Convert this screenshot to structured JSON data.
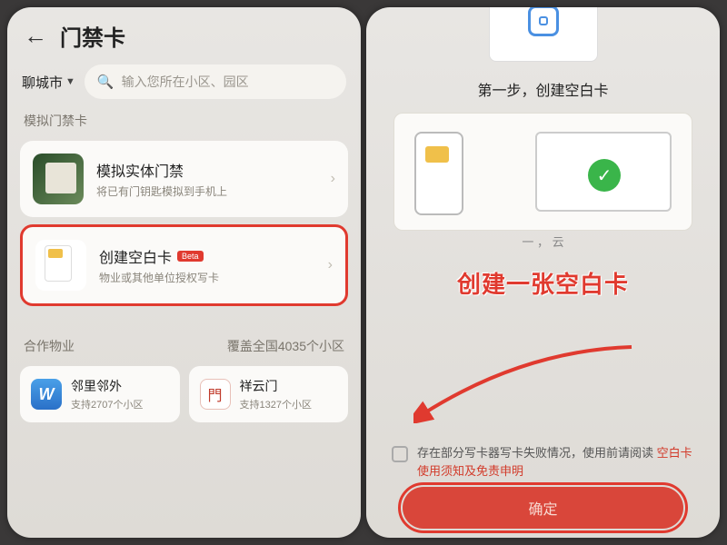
{
  "left": {
    "title": "门禁卡",
    "city": "聊城市",
    "search_placeholder": "输入您所在小区、园区",
    "section1": "模拟门禁卡",
    "card_physical": {
      "title": "模拟实体门禁",
      "sub": "将已有门钥匙模拟到手机上"
    },
    "card_blank": {
      "title": "创建空白卡",
      "badge": "Beta",
      "sub": "物业或其他单位授权写卡"
    },
    "section2_left": "合作物业",
    "section2_right": "覆盖全国4035个小区",
    "coop_a": {
      "title": "邻里邻外",
      "sub": "支持2707个小区"
    },
    "coop_b": {
      "title": "祥云门",
      "sub": "支持1327个小区"
    }
  },
  "right": {
    "step": "第一步，创建空白卡",
    "dots": "一 ， 云",
    "callout": "创建一张空白卡",
    "disclaimer_1": "存在部分写卡器写卡失败情况，使用前请阅读",
    "disclaimer_2": "空白卡使用须知及免责申明",
    "button": "确定"
  }
}
